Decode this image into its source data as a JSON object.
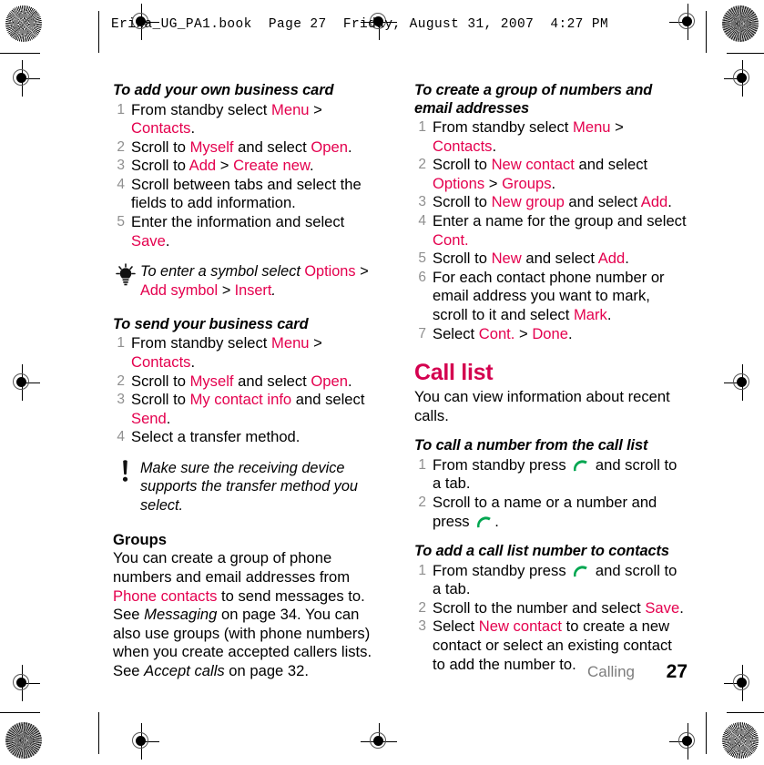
{
  "print_marks": {
    "header_line": "Erika_UG_PA1.book  Page 27  Friday, August 31, 2007  4:27 PM"
  },
  "left_column": {
    "proc1": {
      "title": "To add your own business card",
      "steps": [
        "From standby select <span class=\"ui\">Menu</span> &gt; <span class=\"ui\">Contacts</span>.",
        "Scroll to <span class=\"ui\">Myself</span> and select <span class=\"ui\">Open</span>.",
        "Scroll to <span class=\"ui\">Add</span> &gt; <span class=\"ui\">Create new</span>.",
        "Scroll between tabs and select the fields to add information.",
        "Enter the information and select <span class=\"ui\">Save</span>."
      ]
    },
    "tip": {
      "icon": "lightbulb-icon",
      "text": "To enter a symbol select <span class=\"ui\">Options</span> &gt; <span class=\"ui\">Add symbol</span> &gt; <span class=\"ui\">Insert</span>."
    },
    "proc2": {
      "title": "To send your business card",
      "steps": [
        "From standby select <span class=\"ui\">Menu</span> &gt; <span class=\"ui\">Contacts</span>.",
        "Scroll to <span class=\"ui\">Myself</span> and select <span class=\"ui\">Open</span>.",
        "Scroll to <span class=\"ui\">My contact info</span> and select <span class=\"ui\">Send</span>.",
        "Select a transfer method."
      ]
    },
    "note": {
      "icon": "exclamation-icon",
      "text": "Make sure the receiving device supports the transfer method you select."
    },
    "groups": {
      "heading": "Groups",
      "body": "You can create a group of phone numbers and email addresses from <span class=\"ui\">Phone contacts</span> to send messages to. See <span class=\"em\">Messaging</span> on page 34. You can also use groups (with phone numbers) when you create accepted callers lists. See <span class=\"em\">Accept calls</span> on page 32."
    }
  },
  "right_column": {
    "proc3": {
      "title": "To create a group of numbers and email addresses",
      "steps": [
        "From standby select <span class=\"ui\">Menu</span> &gt; <span class=\"ui\">Contacts</span>.",
        "Scroll to <span class=\"ui\">New contact</span> and select <span class=\"ui\">Options</span> &gt; <span class=\"ui\">Groups</span>.",
        "Scroll to <span class=\"ui\">New group</span> and select <span class=\"ui\">Add</span>.",
        "Enter a name for the group and select <span class=\"ui\">Cont.</span>",
        "Scroll to <span class=\"ui\">New</span> and select <span class=\"ui\">Add</span>.",
        "For each contact phone number or email address you want to mark, scroll to it and select <span class=\"ui\">Mark</span>.",
        "Select <span class=\"ui\">Cont.</span> &gt; <span class=\"ui\">Done</span>."
      ]
    },
    "section": {
      "heading": "Call list",
      "body": "You can view information about recent calls."
    },
    "proc4": {
      "title": "To call a number from the call list",
      "steps": [
        "From standby press <span class=\"handset-slot\"></span> and scroll to a tab.",
        "Scroll to a name or a number and press <span class=\"handset-slot\"></span>."
      ]
    },
    "proc5": {
      "title": "To add a call list number to contacts",
      "steps": [
        "From standby press <span class=\"handset-slot\"></span> and scroll to a tab.",
        "Scroll to the number and select <span class=\"ui\">Save</span>.",
        "Select <span class=\"ui\">New contact</span> to create a new contact or select an existing contact to add the number to."
      ]
    }
  },
  "footer": {
    "chapter": "Calling",
    "page_number": "27"
  },
  "colors": {
    "accent_pink": "#e4004e",
    "heading_pink": "#d4004f",
    "call_green": "#00a650",
    "step_number_gray": "#8f8f8f",
    "footer_gray": "#7d7d7d"
  }
}
